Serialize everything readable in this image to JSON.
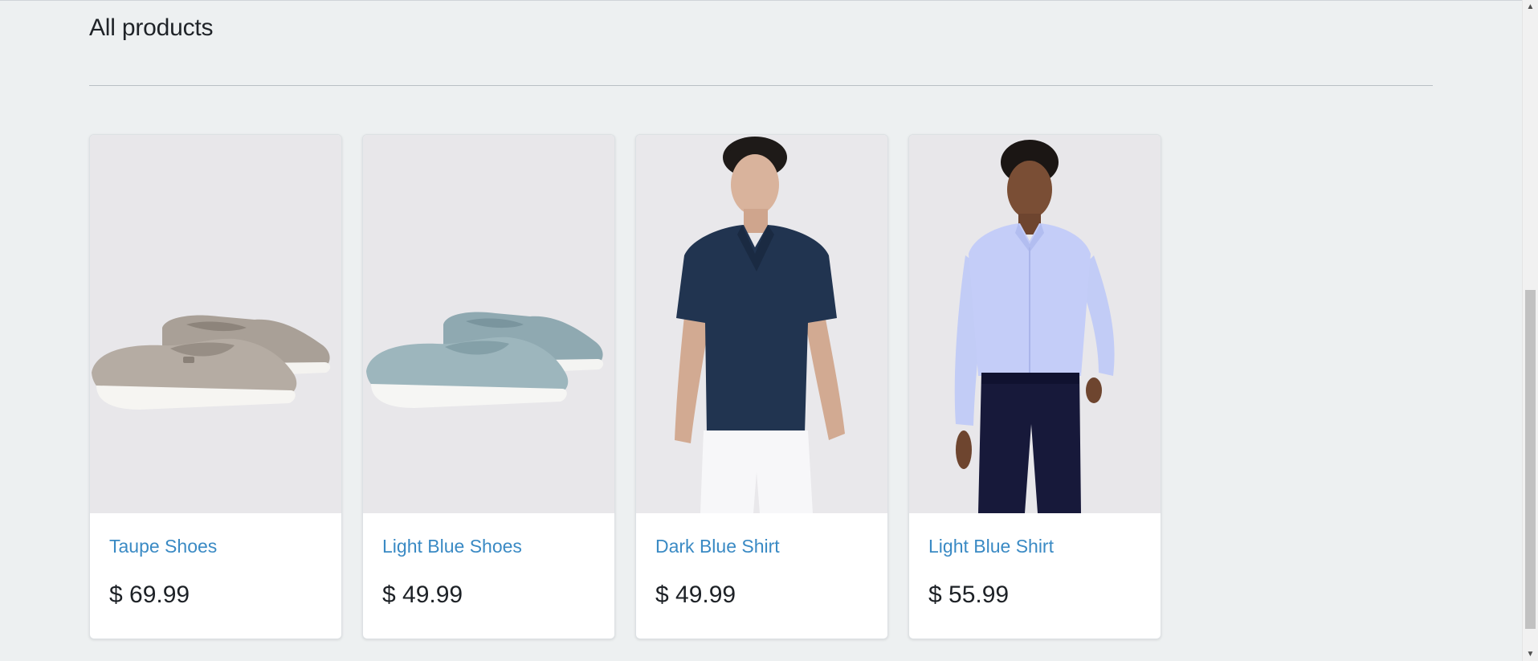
{
  "section": {
    "title": "All products"
  },
  "products": [
    {
      "name": "Taupe Shoes",
      "price": "$ 69.99",
      "image_icon": "taupe-loafers-image"
    },
    {
      "name": "Light Blue Shoes",
      "price": "$ 49.99",
      "image_icon": "light-blue-loafers-image"
    },
    {
      "name": "Dark Blue Shirt",
      "price": "$ 49.99",
      "image_icon": "dark-blue-polo-model-image"
    },
    {
      "name": "Light Blue Shirt",
      "price": "$ 55.99",
      "image_icon": "light-blue-dress-shirt-model-image"
    }
  ],
  "colors": {
    "background": "#edf0f1",
    "link": "#3a8ac4",
    "price": "#1d2126",
    "image_bg": "#e8e7ea"
  },
  "scrollbar": {
    "up_icon": "scroll-up-arrow-icon",
    "down_icon": "scroll-down-arrow-icon"
  }
}
